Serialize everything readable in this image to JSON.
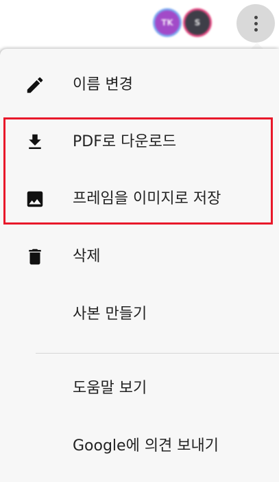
{
  "header": {
    "avatars": [
      {
        "initials": "TK",
        "color": "#a24ac8",
        "ring_color": "#7aa8f0"
      },
      {
        "initials": "S",
        "color": "#3e3e48",
        "ring_color": "#e24680"
      }
    ],
    "more_button_icon": "more-vert-icon"
  },
  "menu": {
    "items": [
      {
        "label": "이름 변경",
        "icon": "pencil-icon"
      },
      {
        "label": "PDF로 다운로드",
        "icon": "download-icon"
      },
      {
        "label": "프레임을 이미지로 저장",
        "icon": "image-icon"
      },
      {
        "label": "삭제",
        "icon": "trash-icon"
      },
      {
        "label": "사본 만들기",
        "icon": ""
      },
      {
        "label": "도움말 보기",
        "icon": ""
      },
      {
        "label": "Google에 의견 보내기",
        "icon": ""
      }
    ]
  },
  "highlight": {
    "color": "#e8182a"
  }
}
